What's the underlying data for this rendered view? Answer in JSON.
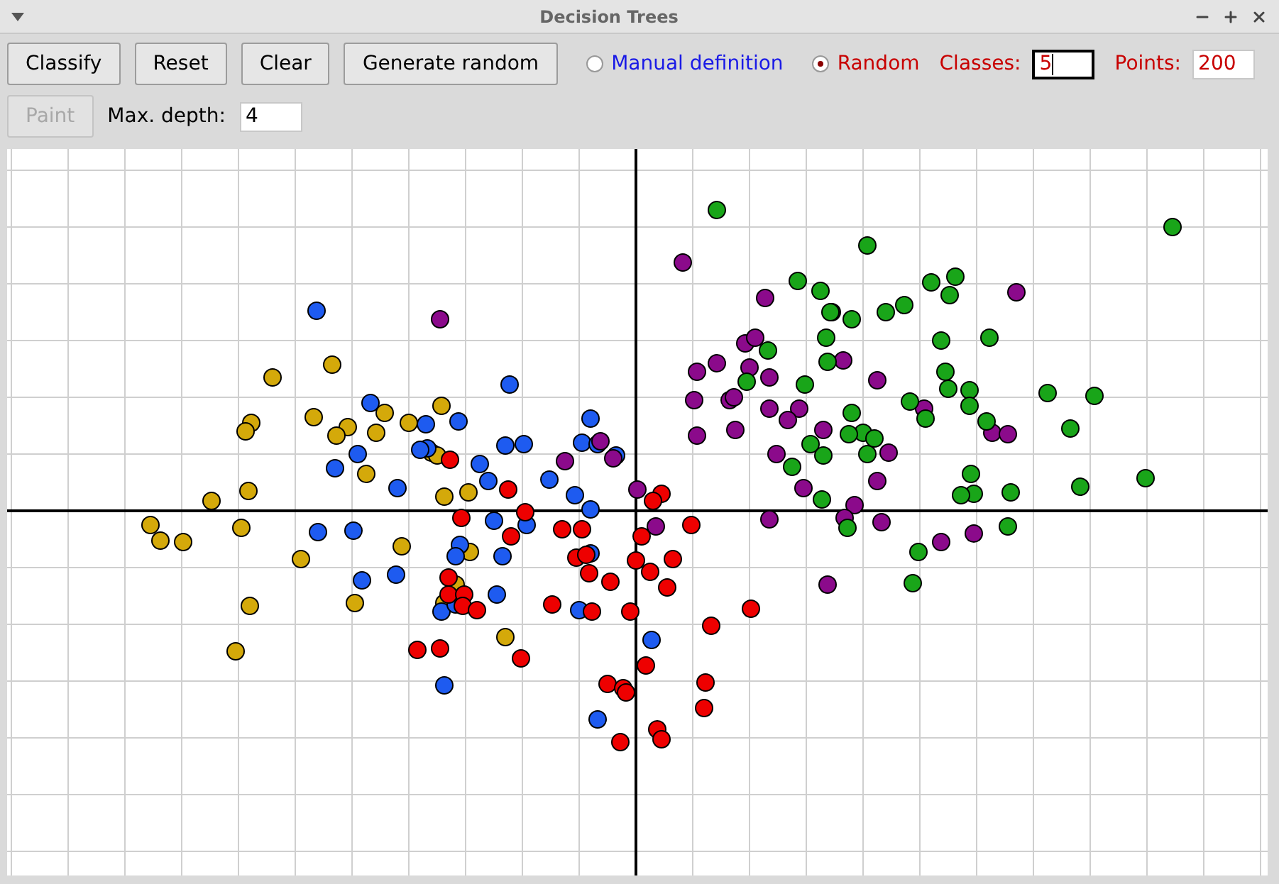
{
  "window": {
    "title": "Decision Trees"
  },
  "toolbar": {
    "buttons": [
      {
        "label": "Classify",
        "disabled": false
      },
      {
        "label": "Reset",
        "disabled": false
      },
      {
        "label": "Clear",
        "disabled": false
      },
      {
        "label": "Generate random",
        "disabled": false
      }
    ],
    "modes": [
      {
        "label": "Manual definition",
        "selected": false
      },
      {
        "label": "Random",
        "selected": true
      }
    ],
    "fields": [
      {
        "label": "Classes:",
        "value": "5",
        "focused": true
      },
      {
        "label": "Points:",
        "value": "200",
        "focused": false
      }
    ]
  },
  "second_row": {
    "paint_button": {
      "label": "Paint",
      "disabled": true
    },
    "depth": {
      "label": "Max. depth:",
      "value": "4"
    }
  }
}
